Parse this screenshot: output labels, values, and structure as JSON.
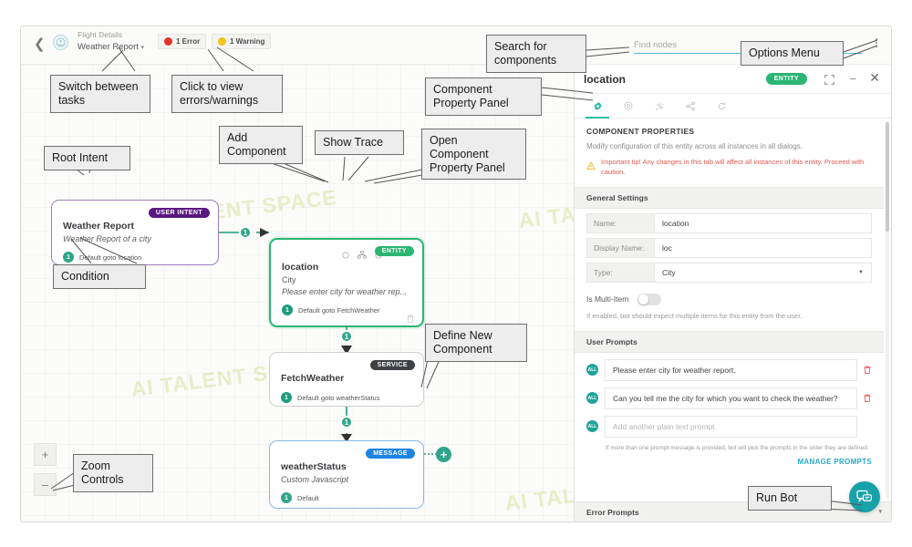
{
  "header": {
    "back_icon": "chevron-left-icon",
    "avatar_icon": "bot-avatar-icon",
    "breadcrumb_parent": "Flight Details",
    "breadcrumb_task": "Weather Report",
    "task_caret": "▾",
    "error_badge": "1 Error",
    "warning_badge": "1 Warning",
    "error_color": "#e0332b",
    "warning_color": "#f0c419",
    "find_nodes_value": "",
    "find_nodes_placeholder": "Find nodes",
    "options_menu_icon": "kebab-menu-icon"
  },
  "canvas": {
    "watermark": "AI TALENT SPACE",
    "zoom_in": "+",
    "zoom_out": "–",
    "nodes": [
      {
        "id": "intent",
        "title": "Weather Report",
        "subtitle": "Weather Report of a city",
        "tag": "USER INTENT",
        "tag_color": "#5b1780",
        "transition_num": "1",
        "transition_text": "Default goto location"
      },
      {
        "id": "location",
        "title": "location",
        "subtitle": "City",
        "subtitle2": "Please enter city for weather rep...",
        "tag": "ENTITY",
        "tag_color": "#2bb673",
        "transition_num": "1",
        "transition_text": "Default goto FetchWeather",
        "toolbar": [
          "add-component-icon",
          "show-trace-icon",
          "open-property-panel-icon"
        ],
        "delete_icon": "trash-icon"
      },
      {
        "id": "service",
        "title": "FetchWeather",
        "tag": "SERVICE",
        "tag_color": "#3f4045",
        "transition_num": "1",
        "transition_text": "Default goto weatherStatus"
      },
      {
        "id": "message",
        "title": "weatherStatus",
        "subtitle": "Custom Javascript",
        "tag": "MESSAGE",
        "tag_color": "#1c84e3",
        "transition_num": "1",
        "transition_text": "Default"
      }
    ],
    "connector_labels": [
      "1",
      "1",
      "1",
      "1"
    ],
    "define_new_component_icon": "plus-circle-icon"
  },
  "panel": {
    "title": "location",
    "entity_tag": "ENTITY",
    "expand_icon": "expand-icon",
    "minimize_icon": "minimize-icon",
    "close_icon": "close-icon",
    "tabs": [
      {
        "name": "settings-tab",
        "icon": "gear-icon",
        "active": true
      },
      {
        "name": "instance-tab",
        "icon": "target-icon",
        "active": false
      },
      {
        "name": "connections-tab",
        "icon": "plug-icon",
        "active": false
      },
      {
        "name": "share-tab",
        "icon": "share-icon",
        "active": false
      },
      {
        "name": "history-tab",
        "icon": "refresh-icon",
        "active": false
      }
    ],
    "component_properties_title": "COMPONENT PROPERTIES",
    "component_properties_desc": "Modify configuration of this entity across all instances in all dialogs.",
    "tip_icon": "warning-triangle-icon",
    "tip_text": "Important tip! Any changes in this tab will affect all instances of this entity. Proceed with caution.",
    "general_settings_title": "General Settings",
    "fields": [
      {
        "label": "Name:",
        "value": "location",
        "type": "text"
      },
      {
        "label": "Display Name:",
        "value": "loc",
        "type": "text"
      },
      {
        "label": "Type:",
        "value": "City",
        "type": "select"
      }
    ],
    "multi_item_label": "Is Multi-Item",
    "multi_item_enabled": false,
    "multi_item_help": "If enabled, bot should expect multiple items for this entity from the user.",
    "user_prompts_title": "User Prompts",
    "prompts": [
      {
        "avatar": "ALL",
        "value": "Please enter city for weather report.",
        "placeholder": "",
        "deletable": true
      },
      {
        "avatar": "ALL",
        "value": "Can you tell me the city for which you want to check the weather?",
        "placeholder": "",
        "deletable": true
      },
      {
        "avatar": "ALL",
        "value": "",
        "placeholder": "Add another plain text prompt",
        "deletable": false
      }
    ],
    "prompts_help": "If more than one prompt message is provided, bot will pick the prompts in the order they are defined.",
    "manage_prompts": "MANAGE PROMPTS",
    "error_prompts_title": "Error Prompts",
    "error_prompts_caret": "▾",
    "run_bot_icon": "chat-bot-icon"
  },
  "annotations": [
    {
      "id": "switch-tasks",
      "text": "Switch between\ntasks"
    },
    {
      "id": "errors-warnings",
      "text": "Click to view\nerrors/warnings"
    },
    {
      "id": "search-components",
      "text": "Search for\ncomponents"
    },
    {
      "id": "options-menu",
      "text": "Options Menu"
    },
    {
      "id": "component-property-panel",
      "text": "Component\nProperty Panel"
    },
    {
      "id": "root-intent",
      "text": "Root Intent"
    },
    {
      "id": "add-component",
      "text": "Add\nComponent"
    },
    {
      "id": "show-trace",
      "text": "Show Trace"
    },
    {
      "id": "open-component-property-panel",
      "text": "Open\nComponent\nProperty Panel"
    },
    {
      "id": "condition",
      "text": "Condition"
    },
    {
      "id": "define-new-component",
      "text": "Define New\nComponent"
    },
    {
      "id": "zoom-controls",
      "text": "Zoom\nControls"
    },
    {
      "id": "run-bot",
      "text": "Run Bot"
    }
  ]
}
